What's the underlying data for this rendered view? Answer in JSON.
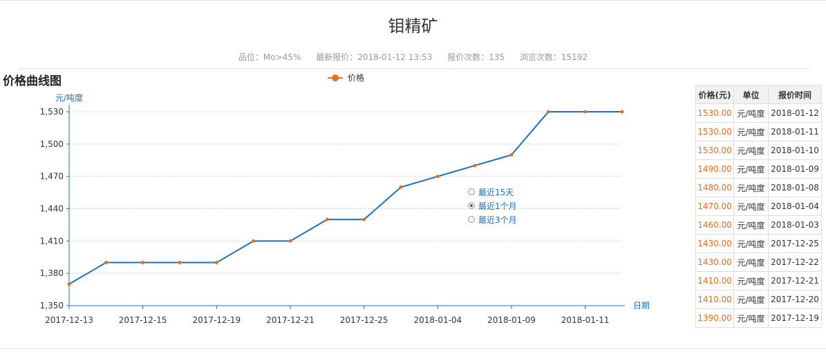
{
  "page": {
    "title": "钼精矿",
    "meta": {
      "grade": "品位：Mo>45%",
      "latest": "最新报价：2018-01-12 13:53",
      "quotes": "报价次数：135",
      "views": "浏览次数：15192"
    },
    "section_title": "价格曲线图"
  },
  "range_options": [
    {
      "label": "最近15天",
      "checked": false
    },
    {
      "label": "最近1个月",
      "checked": true
    },
    {
      "label": "最近3个月",
      "checked": false
    }
  ],
  "table": {
    "headers": [
      "价格(元)",
      "单位",
      "报价时间"
    ],
    "rows": [
      [
        "1530.00",
        "元/吨度",
        "2018-01-12"
      ],
      [
        "1530.00",
        "元/吨度",
        "2018-01-11"
      ],
      [
        "1530.00",
        "元/吨度",
        "2018-01-10"
      ],
      [
        "1490.00",
        "元/吨度",
        "2018-01-09"
      ],
      [
        "1480.00",
        "元/吨度",
        "2018-01-08"
      ],
      [
        "1470.00",
        "元/吨度",
        "2018-01-04"
      ],
      [
        "1460.00",
        "元/吨度",
        "2018-01-03"
      ],
      [
        "1430.00",
        "元/吨度",
        "2017-12-25"
      ],
      [
        "1430.00",
        "元/吨度",
        "2017-12-22"
      ],
      [
        "1410.00",
        "元/吨度",
        "2017-12-21"
      ],
      [
        "1410.00",
        "元/吨度",
        "2017-12-20"
      ],
      [
        "1390.00",
        "元/吨度",
        "2017-12-19"
      ]
    ]
  },
  "chart_data": {
    "type": "line",
    "ylabel": "元/吨度",
    "xlabel": "日期",
    "ylim": [
      1350,
      1530
    ],
    "yticks": [
      1350,
      1380,
      1410,
      1440,
      1470,
      1500,
      1530
    ],
    "ytick_labels": [
      "1,350",
      "1,380",
      "1,410",
      "1,440",
      "1,470",
      "1,500",
      "1,530"
    ],
    "xtick_labels": [
      "2017-12-13",
      "2017-12-15",
      "2017-12-19",
      "2017-12-21",
      "2017-12-25",
      "2018-01-04",
      "2018-01-09",
      "2018-01-11"
    ],
    "xtick_indices": [
      0,
      2,
      4,
      6,
      8,
      10,
      12,
      14
    ],
    "grid": true,
    "legend_position": "top-center",
    "series": [
      {
        "name": "价格",
        "x": [
          "2017-12-13",
          "2017-12-14",
          "2017-12-15",
          "2017-12-18",
          "2017-12-19",
          "2017-12-20",
          "2017-12-21",
          "2017-12-22",
          "2017-12-25",
          "2018-01-03",
          "2018-01-04",
          "2018-01-08",
          "2018-01-09",
          "2018-01-10",
          "2018-01-11",
          "2018-01-12"
        ],
        "values": [
          1370,
          1390,
          1390,
          1390,
          1390,
          1410,
          1410,
          1430,
          1430,
          1460,
          1470,
          1480,
          1490,
          1530,
          1530,
          1530
        ]
      }
    ],
    "colors": {
      "line": "#1a6fc0",
      "marker": "#f26b1d",
      "axis": "#1a6fc0",
      "grid": "#cccccc"
    }
  }
}
